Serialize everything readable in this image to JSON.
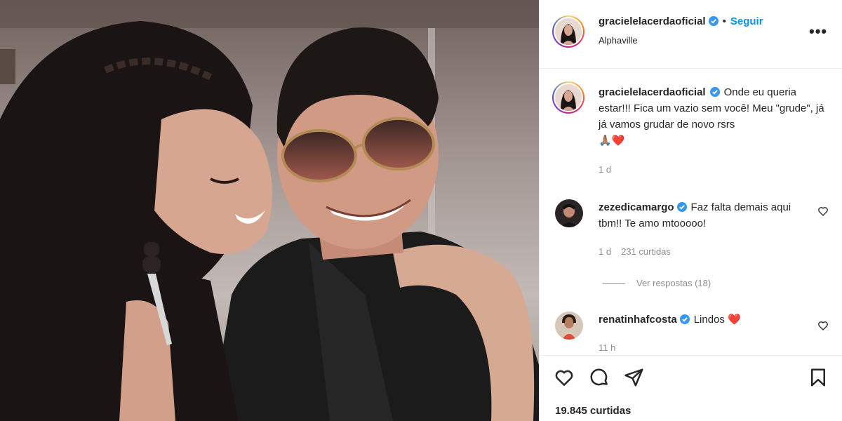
{
  "post": {
    "author": "gracielelacerdaoficial",
    "follow_label": "Seguir",
    "separator": "•",
    "location": "Alphaville",
    "more_icon": "more-horizontal-icon",
    "caption": "Onde eu queria estar!!! Fica um vazio sem você! Meu \"grude\", já já vamos grudar de novo rsrs",
    "caption_emojis": "🙏🏽❤️",
    "caption_time": "1 d",
    "likes": "19.845 curtidas"
  },
  "comments": [
    {
      "user": "zezedicamargo",
      "text": "Faz falta demais aqui tbm!! Te amo mtooooo!",
      "time": "1 d",
      "likes": "231 curtidas",
      "replies": "Ver respostas (18)"
    },
    {
      "user": "renatinhafcosta",
      "text": "Lindos",
      "text_emoji": "❤️",
      "time": "11 h"
    }
  ],
  "colors": {
    "link_blue": "#0095f6",
    "verified_blue": "#3897f0",
    "text": "#262626",
    "muted": "#8e8e8e",
    "heart_red": "#ed4956"
  },
  "icons": [
    "verified-badge-icon",
    "heart-icon",
    "comment-icon",
    "share-icon",
    "bookmark-icon",
    "more-horizontal-icon"
  ]
}
